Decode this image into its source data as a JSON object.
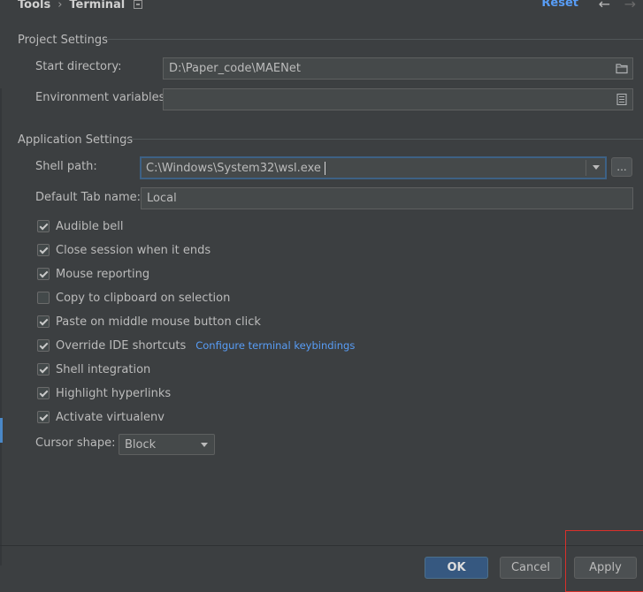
{
  "header": {
    "breadcrumb_parent": "Tools",
    "breadcrumb_current": "Terminal",
    "reset_label": "Reset"
  },
  "project_settings": {
    "title": "Project Settings",
    "start_directory_label": "Start directory:",
    "start_directory_value": "D:\\Paper_code\\MAENet",
    "env_vars_label": "Environment variables:",
    "env_vars_value": ""
  },
  "application_settings": {
    "title": "Application Settings",
    "shell_path_label": "Shell path:",
    "shell_path_value": "C:\\Windows\\System32\\wsl.exe",
    "browse_label": "...",
    "default_tab_label": "Default Tab name:",
    "default_tab_value": "Local",
    "checkboxes": [
      {
        "label": "Audible bell",
        "checked": true
      },
      {
        "label": "Close session when it ends",
        "checked": true
      },
      {
        "label": "Mouse reporting",
        "checked": true
      },
      {
        "label": "Copy to clipboard on selection",
        "checked": false
      },
      {
        "label": "Paste on middle mouse button click",
        "checked": true
      },
      {
        "label": "Override IDE shortcuts",
        "checked": true
      },
      {
        "label": "Shell integration",
        "checked": true
      },
      {
        "label": "Highlight hyperlinks",
        "checked": true
      },
      {
        "label": "Activate virtualenv",
        "checked": true
      }
    ],
    "configure_link": "Configure terminal keybindings",
    "cursor_shape_label": "Cursor shape:",
    "cursor_shape_value": "Block"
  },
  "footer": {
    "ok_label": "OK",
    "cancel_label": "Cancel",
    "apply_label": "Apply"
  },
  "colors": {
    "accent": "#589df6",
    "primary_button": "#365880",
    "highlight_box": "#d9302b"
  }
}
